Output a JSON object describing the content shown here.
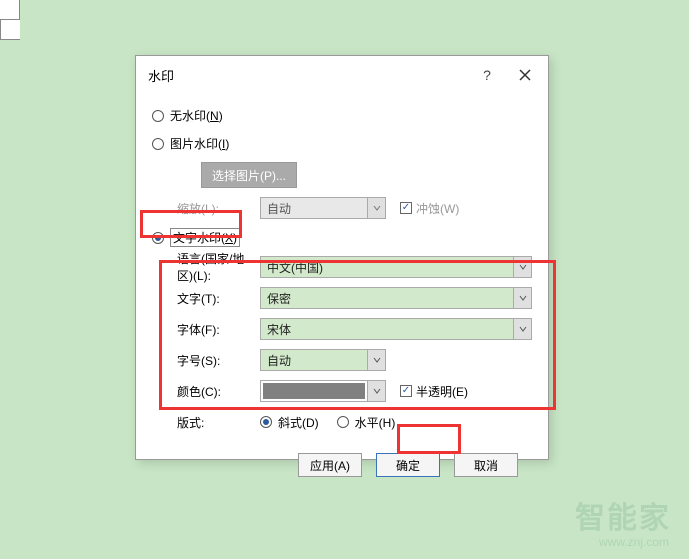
{
  "page_marks": true,
  "watermark": {
    "main": "智能家",
    "sub": "www.znj.com"
  },
  "dialog": {
    "title": "水印",
    "help_icon": "?",
    "radios": {
      "none": {
        "label": "无水印",
        "key": "N",
        "checked": false
      },
      "picture": {
        "label": "图片水印",
        "key": "I",
        "checked": false
      },
      "text": {
        "label": "文字水印",
        "key": "X",
        "checked": true
      }
    },
    "picture_section": {
      "select_button": "选择图片(P)...",
      "scale_label": "缩放(L):",
      "scale_value": "自动",
      "washout_label": "冲蚀(W)",
      "washout_checked": true,
      "enabled": false
    },
    "text_section": {
      "language_label": "语言(国家/地区)(L):",
      "language_value": "中文(中国)",
      "text_label": "文字(T):",
      "text_value": "保密",
      "font_label": "字体(F):",
      "font_value": "宋体",
      "size_label": "字号(S):",
      "size_value": "自动",
      "color_label": "颜色(C):",
      "color_value": "#808080",
      "semi_label": "半透明(E)",
      "semi_checked": true,
      "layout_label": "版式:",
      "layout_diagonal": {
        "label": "斜式(D)",
        "checked": true
      },
      "layout_horizontal": {
        "label": "水平(H)",
        "checked": false
      }
    },
    "buttons": {
      "apply": "应用(A)",
      "ok": "确定",
      "cancel": "取消"
    }
  }
}
